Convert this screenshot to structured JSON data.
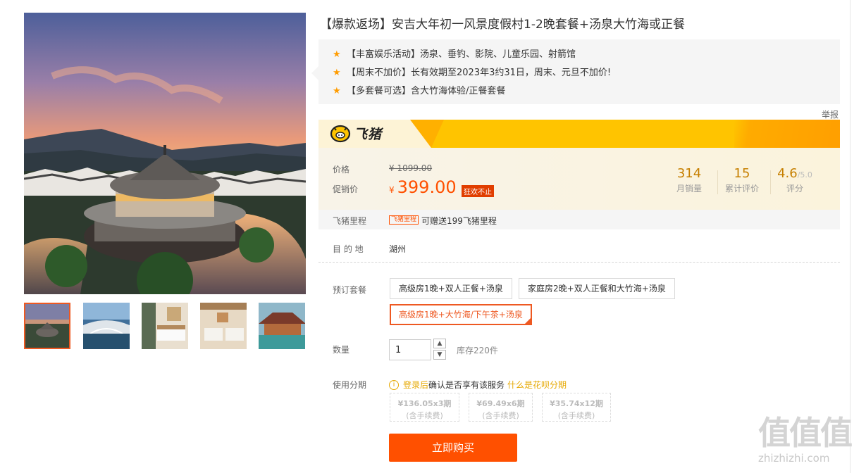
{
  "title": "【爆款返场】安吉大年初一风景度假村1-2晚套餐+汤泉大竹海或正餐",
  "highlights": [
    "【丰富娱乐活动】汤泉、垂钓、影院、儿童乐园、射箭馆",
    "【周末不加价】长有效期至2023年3约31日，周末、元旦不加价!",
    "【多套餐可选】含大竹海体验/正餐套餐"
  ],
  "report_label": "举报",
  "brand": {
    "name": "飞猪",
    "banner_color": "#ffc400"
  },
  "price": {
    "label": "价格",
    "original": "¥ 1099.00",
    "promo_label": "促销价",
    "currency": "¥",
    "promo_value": "399.00",
    "promo_badge": "狂欢不止",
    "accent": "#ff5000"
  },
  "stats": [
    {
      "value": "314",
      "suffix": "",
      "label": "月销量"
    },
    {
      "value": "15",
      "suffix": "",
      "label": "累计评价"
    },
    {
      "value": "4.6",
      "suffix": "/5.0",
      "label": "评分"
    }
  ],
  "mileage": {
    "label": "飞猪里程",
    "tag": "飞猪里程",
    "text": "可赠送199飞猪里程"
  },
  "destination": {
    "label": "目 的 地",
    "value": "湖州"
  },
  "packages": {
    "label": "预订套餐",
    "options": [
      "高级房1晚+双人正餐+汤泉",
      "家庭房2晚+双人正餐和大竹海+汤泉",
      "高级房1晚+大竹海/下午茶+汤泉"
    ],
    "selected_index": 2
  },
  "quantity": {
    "label": "数量",
    "value": "1",
    "stock": "库存220件"
  },
  "installment": {
    "label": "使用分期",
    "info_icon": "i",
    "login": "登录后",
    "note": "确认是否享有该服务",
    "link": "什么是花呗分期",
    "options": [
      {
        "price": "¥136.05x3期",
        "fee": "(含手续费)"
      },
      {
        "price": "¥69.49x6期",
        "fee": "(含手续费)"
      },
      {
        "price": "¥35.74x12期",
        "fee": "(含手续费)"
      }
    ]
  },
  "buy_button": "立即购买",
  "watermark": {
    "chars": "值值值",
    "url": "zhizhizhi.com"
  }
}
